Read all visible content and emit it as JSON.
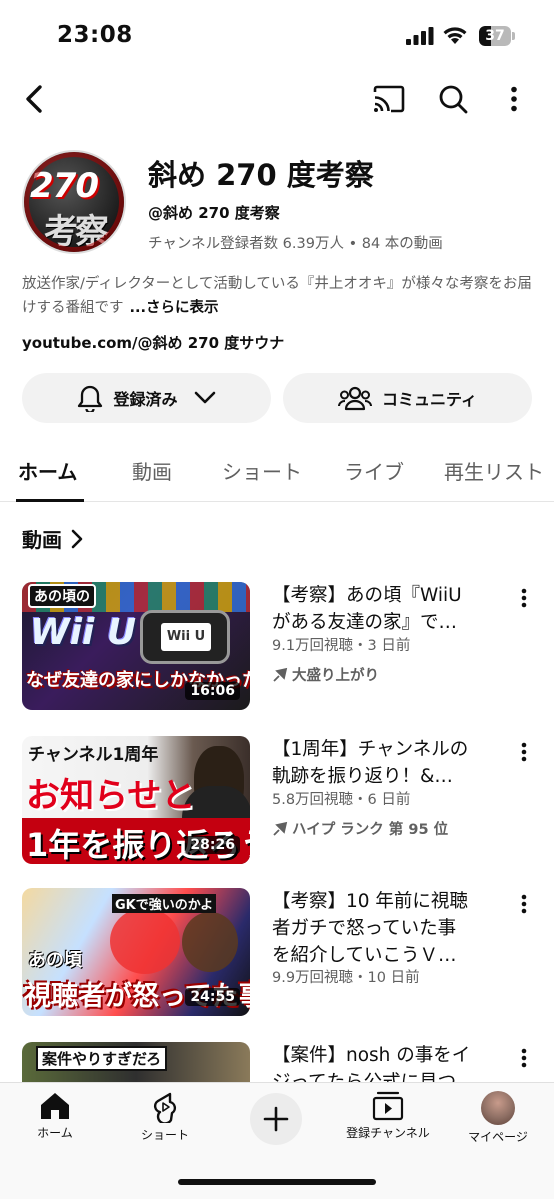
{
  "status_bar": {
    "time": "23:08",
    "battery": "37",
    "battery_fraction": 0.37
  },
  "header": {
    "icons": [
      "back-arrow-icon",
      "cast-icon",
      "search-icon",
      "more-vertical-icon"
    ]
  },
  "channel": {
    "name": "斜め 270 度考察",
    "handle": "@斜め 270 度考察",
    "stats": "チャンネル登録者数 6.39万人 • 84 本の動画",
    "description": "放送作家/ディレクターとして活動している『井上オオキ』が様々な考察をお届けする番組です",
    "description_more": "...さらに表示",
    "link": "youtube.com/@斜め 270 度サウナ",
    "avatar_text_top": "270",
    "avatar_text_bottom": "考察"
  },
  "actions": {
    "subscribe_label": "登録済み",
    "community_label": "コミュニティ"
  },
  "tabs": [
    {
      "label": "ホーム",
      "active": true
    },
    {
      "label": "動画",
      "active": false
    },
    {
      "label": "ショート",
      "active": false
    },
    {
      "label": "ライブ",
      "active": false
    },
    {
      "label": "再生リスト",
      "active": false
    }
  ],
  "section": {
    "title": "動画"
  },
  "videos": [
    {
      "title": "【考察】あの頃『WiiU があある友達の家』で…",
      "title_lines": [
        "【考察】あの頃『WiiU",
        "がある友達の家』で…"
      ],
      "meta": "9.1万回視聴・3 日前",
      "badge": "大盛り上がり",
      "duration": "16:06",
      "thumb_top": "あの頃の",
      "thumb_main": "Wii U",
      "thumb_bottom": "なぜ友達の家にしかなかったのか"
    },
    {
      "title_lines": [
        "【1周年】チャンネルの",
        "軌跡を振り返り！&…"
      ],
      "meta": "5.8万回視聴・6 日前",
      "badge": "ハイプ ランク 第 95 位",
      "duration": "28:26",
      "thumb_top": "チャンネル1周年",
      "thumb_main": "お知らせと",
      "thumb_bottom": "1年を振り返ろう"
    },
    {
      "title_lines": [
        "【考察】10 年前に視聴",
        "者ガチで怒っていた事",
        "を紹介していこうＶ…"
      ],
      "meta": "9.9万回視聴・10 日前",
      "duration": "24:55",
      "thumb_top": "GKで強いのかよ",
      "thumb_main": "あの頃",
      "thumb_bottom": "視聴者が怒ってた事"
    },
    {
      "title_lines": [
        "【案件】nosh の事をイ",
        "ジってたら公式に見つ"
      ],
      "thumb_top": "案件やりすぎだろ"
    }
  ],
  "bottom_nav": {
    "home": "ホーム",
    "shorts": "ショート",
    "subscriptions": "登録チャンネル",
    "you": "マイページ"
  }
}
